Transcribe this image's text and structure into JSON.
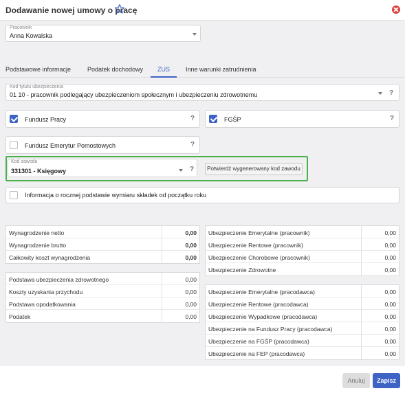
{
  "header": {
    "title": "Dodawanie nowej umowy o pracę"
  },
  "employee": {
    "label": "Pracownik",
    "value": "Anna Kowalska"
  },
  "tabs": [
    {
      "label": "Podstawowe informacje"
    },
    {
      "label": "Podatek dochodowy"
    },
    {
      "label": "ZUS"
    },
    {
      "label": "Inne warunki zatrudnienia"
    }
  ],
  "zus": {
    "insurance_code": {
      "label": "Kod tytułu ubezpieczenia",
      "value": "01 10 - pracownik podlegający ubezpieczeniom społecznym i ubezpieczeniu zdrowotnemu"
    },
    "fundusz_pracy": {
      "label": "Fundusz Pracy",
      "checked": true
    },
    "fgsp": {
      "label": "FGŚP",
      "checked": true
    },
    "fep": {
      "label": "Fundusz Emerytur Pomostowych",
      "checked": false
    },
    "profession_code": {
      "label": "Kod zawodu",
      "value": "331301 - Księgowy"
    },
    "confirm_button": "Potwierdź wygenerowany kod zawodu",
    "annual_info": {
      "label": "Informacja o rocznej podstawie wymiaru składek od początku roku",
      "checked": false
    },
    "help": "?"
  },
  "summary_left_1": [
    {
      "label": "Wynagrodzenie netto",
      "value": "0,00"
    },
    {
      "label": "Wynagrodzenie brutto",
      "value": "0,00"
    },
    {
      "label": "Całkowity koszt wynagrodzenia",
      "value": "0,00"
    }
  ],
  "summary_left_2": [
    {
      "label": "Podstawa ubezpieczenia zdrowotnego",
      "value": "0,00"
    },
    {
      "label": "Koszty uzyskania przychodu",
      "value": "0,00"
    },
    {
      "label": "Podstawa opodatkowania",
      "value": "0,00"
    },
    {
      "label": "Podatek",
      "value": "0,00"
    }
  ],
  "summary_right_1": [
    {
      "label": "Ubezpieczenie Emerytalne (pracownik)",
      "value": "0,00"
    },
    {
      "label": "Ubezpieczenie Rentowe (pracownik)",
      "value": "0,00"
    },
    {
      "label": "Ubezpieczenie Chorobowe (pracownik)",
      "value": "0,00"
    },
    {
      "label": "Ubezpieczenie Zdrowotne",
      "value": "0,00"
    }
  ],
  "summary_right_2": [
    {
      "label": "Ubezpieczenie Emerytalne (pracodawca)",
      "value": "0,00"
    },
    {
      "label": "Ubezpieczenie Rentowe (pracodawca)",
      "value": "0,00"
    },
    {
      "label": "Ubezpieczenie Wypadkowe (pracodawca)",
      "value": "0,00"
    },
    {
      "label": "Ubezpieczenie na Fundusz Pracy (pracodawca)",
      "value": "0,00"
    },
    {
      "label": "Ubezpieczenie na FGŚP (pracodawca)",
      "value": "0,00"
    },
    {
      "label": "Ubezpieczenie na FEP (pracodawca)",
      "value": "0,00"
    }
  ],
  "footer": {
    "cancel": "Anuluj",
    "save": "Zapisz"
  },
  "colors": {
    "accent": "#3d64c4",
    "highlight": "#4bb14b",
    "close": "#e0403a"
  }
}
